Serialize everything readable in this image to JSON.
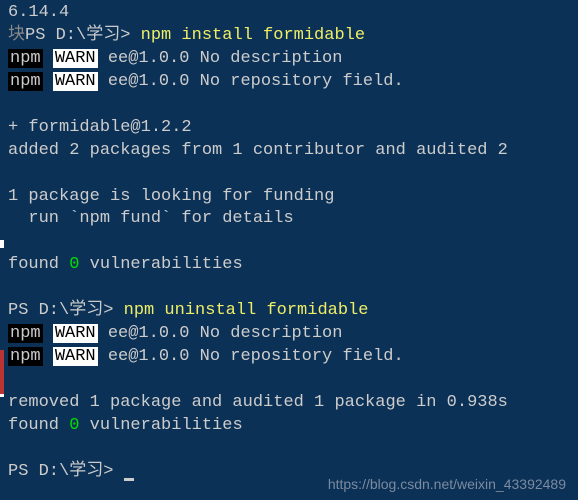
{
  "lines": {
    "version": "6.14.4",
    "prompt1_prefix": "PS D:\\学习> ",
    "cmd1": "npm install formidable",
    "npm_label": "npm",
    "warn_label": "WARN",
    "warn1_text": " ee@1.0.0 No description",
    "warn2_text": " ee@1.0.0 No repository field.",
    "installed": "+ formidable@1.2.2",
    "added": "added 2 packages from 1 contributor and audited 2",
    "funding1": "1 package is looking for funding",
    "funding2": "  run `npm fund` for details",
    "found_prefix": "found ",
    "zero": "0",
    "vuln_suffix": " vulnerabilities",
    "prompt2_prefix": "PS D:\\学习> ",
    "cmd2": "npm uninstall formidable",
    "removed": "removed 1 package and audited 1 package in 0.938s",
    "prompt3": "PS D:\\学习> "
  },
  "truncated_char": "块",
  "watermark": "https://blog.csdn.net/weixin_43392489"
}
